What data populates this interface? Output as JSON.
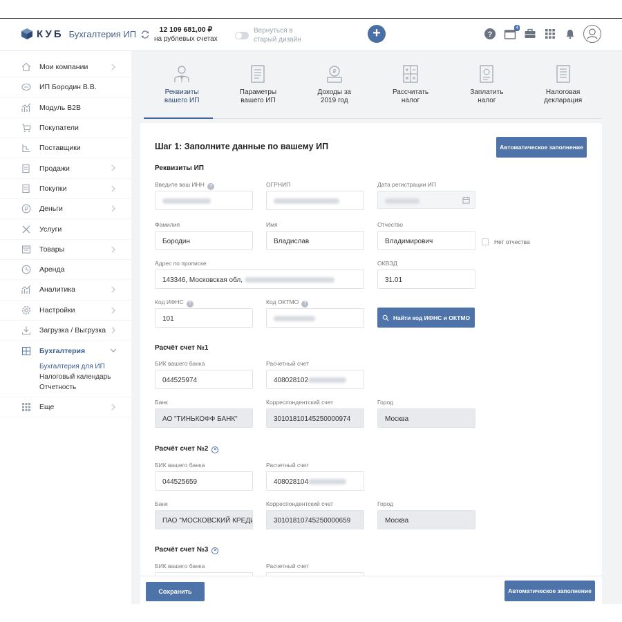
{
  "header": {
    "logo": "КУБ",
    "app_name": "Бухгалтерия ИП",
    "balance_amount": "12 109 681,00 ₽",
    "balance_sub": "на рублевых счетах",
    "toggle_label_line1": "Вернуться в",
    "toggle_label_line2": "старый дизайн",
    "notifications_badge": "4"
  },
  "sidebar": {
    "items": [
      {
        "label": "Мои компании",
        "icon": "home-icon"
      },
      {
        "label": "ИП Бородин В.В.",
        "icon": "company-icon"
      },
      {
        "label": "Модуль B2B",
        "icon": "chart-icon"
      },
      {
        "label": "Покупатели",
        "icon": "cart-icon"
      },
      {
        "label": "Поставщики",
        "icon": "supplier-icon"
      },
      {
        "label": "Продажи",
        "icon": "sales-icon"
      },
      {
        "label": "Покупки",
        "icon": "purchases-icon"
      },
      {
        "label": "Деньги",
        "icon": "money-icon"
      },
      {
        "label": "Услуги",
        "icon": "services-icon"
      },
      {
        "label": "Товары",
        "icon": "goods-icon"
      },
      {
        "label": "Аренда",
        "icon": "rent-icon"
      },
      {
        "label": "Аналитика",
        "icon": "analytics-icon"
      },
      {
        "label": "Настройки",
        "icon": "gear-icon"
      },
      {
        "label": "Загрузка / Выгрузка",
        "icon": "upload-icon"
      },
      {
        "label": "Бухгалтерия",
        "icon": "accounting-icon"
      }
    ],
    "sub_items": [
      "Бухгалтерия для ИП",
      "Налоговый календарь",
      "Отчетность"
    ],
    "more_label": "Еще"
  },
  "steps": [
    {
      "line1": "Реквизиты",
      "line2": "вашего ИП"
    },
    {
      "line1": "Параметры",
      "line2": "вашего ИП"
    },
    {
      "line1": "Доходы за",
      "line2": "2019 год"
    },
    {
      "line1": "Рассчитать",
      "line2": "налог"
    },
    {
      "line1": "Заплатить",
      "line2": "налог"
    },
    {
      "line1": "Налоговая",
      "line2": "декларация"
    }
  ],
  "form": {
    "title": "Шаг 1: Заполните данные по вашему ИП",
    "auto_fill_label": "Автоматическое заполнение",
    "requisites_title": "Реквизиты ИП",
    "inn_label": "Введите ваш ИНН",
    "ogrnip_label": "ОГРНИП",
    "reg_date_label": "Дата регистрации ИП",
    "surname_label": "Фамилия",
    "surname_value": "Бородин",
    "name_label": "Имя",
    "name_value": "Владислав",
    "patronymic_label": "Отчество",
    "patronymic_value": "Владимирович",
    "no_patronymic_label": "Нет отчества",
    "address_label": "Адрес по прописке",
    "address_value": "143346, Московская обл,",
    "okved_label": "ОКВЭД",
    "okved_value": "31.01",
    "ifns_label": "Код ИФНС",
    "ifns_value": "101",
    "oktmo_label": "Код ОКТМО",
    "find_button_label": "Найти код ИФНС и ОКТМО",
    "accounts": [
      {
        "title": "Расчёт счет №1",
        "bik_label": "БИК вашего банка",
        "bik_value": "044525974",
        "account_label": "Расчетный счет",
        "account_value": "408028102",
        "bank_label": "Банк",
        "bank_value": "АО \"ТИНЬКОФФ БАНК\"",
        "corr_label": "Корреспондентский счет",
        "corr_value": "30101810145250000974",
        "city_label": "Город",
        "city_value": "Москва"
      },
      {
        "title": "Расчёт счет №2",
        "bik_label": "БИК вашего банка",
        "bik_value": "044525659",
        "account_label": "Расчетный счет",
        "account_value": "408028104",
        "bank_label": "Банк",
        "bank_value": "ПАО \"МОСКОВСКИЙ КРЕДИ",
        "corr_label": "Корреспондентский счет",
        "corr_value": "30101810745250000659",
        "city_label": "Город",
        "city_value": "Москва"
      },
      {
        "title": "Расчёт счет №3",
        "bik_label": "БИК вашего банка",
        "account_label": "Расчетный счет"
      }
    ]
  },
  "footer": {
    "save_label": "Сохранить",
    "auto_fill_label": "Автоматическое заполнение"
  },
  "colors": {
    "accent": "#4d73a8",
    "content_bg": "#f2f3f5",
    "readonly_bg": "#e8eaed"
  }
}
